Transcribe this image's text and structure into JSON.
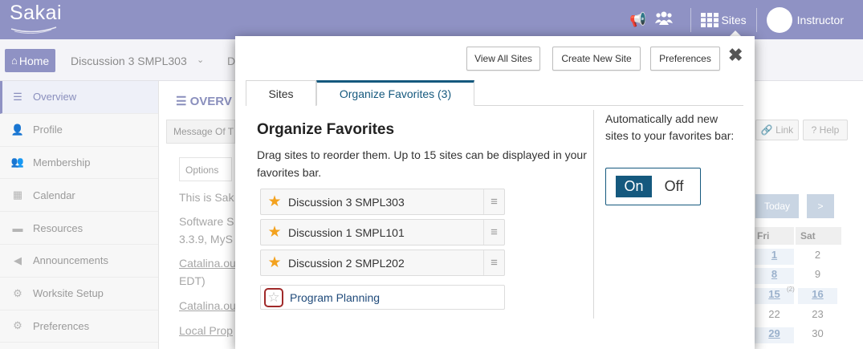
{
  "topbar": {
    "logo": "Sakai",
    "sites_label": "Sites",
    "user_name": "Instructor",
    "bg_color": "#8f92c4"
  },
  "breadcrumb": {
    "home_label": "Home",
    "site_name": "Discussion 3 SMPL303",
    "next_partial": "D"
  },
  "leftnav": {
    "items": [
      {
        "label": "Overview",
        "icon": "list-icon",
        "active": true
      },
      {
        "label": "Profile",
        "icon": "user-icon"
      },
      {
        "label": "Membership",
        "icon": "users-icon"
      },
      {
        "label": "Calendar",
        "icon": "calendar-icon"
      },
      {
        "label": "Resources",
        "icon": "folder-icon"
      },
      {
        "label": "Announcements",
        "icon": "megaphone-icon"
      },
      {
        "label": "Worksite Setup",
        "icon": "cogs-icon"
      },
      {
        "label": "Preferences",
        "icon": "gear-icon"
      }
    ]
  },
  "main": {
    "overview_title": "OVERV",
    "motd_label": "Message Of T",
    "options_label": "Options",
    "lines": [
      "This is Sak",
      "Software S",
      "3.3.9, MyS",
      "EDT)"
    ],
    "links": [
      "Catalina.ou",
      "Catalina.ou",
      "Local Prop"
    ],
    "link_btn": "Link",
    "help_btn": "Help",
    "today_btn": "Today",
    "next_btn": ">",
    "cal_days": [
      "Fri",
      "Sat"
    ],
    "cal_rows": [
      {
        "fri": "1",
        "sat": "2"
      },
      {
        "fri": "8",
        "sat": "9"
      },
      {
        "fri": "15",
        "sat": "16",
        "note": "(2)"
      },
      {
        "fri": "22",
        "sat": "23"
      },
      {
        "fri": "29",
        "sat": "30"
      }
    ]
  },
  "modal": {
    "view_all_label": "View All Sites",
    "create_new_label": "Create New Site",
    "preferences_label": "Preferences",
    "close_icon": "close-icon",
    "tabs": [
      {
        "label": "Sites",
        "active": false
      },
      {
        "label": "Organize Favorites (3)",
        "active": true
      }
    ],
    "heading": "Organize Favorites",
    "description": "Drag sites to reorder them. Up to 15 sites can be displayed in your favorites bar.",
    "favorites": [
      {
        "name": "Discussion 3 SMPL303",
        "starred": true
      },
      {
        "name": "Discussion 1 SMPL101",
        "starred": true
      },
      {
        "name": "Discussion 2 SMPL202",
        "starred": true
      },
      {
        "name": "Program Planning",
        "starred": false
      }
    ],
    "auto_add_text": "Automatically add new sites to your favorites bar:",
    "toggle_on": "On",
    "toggle_off": "Off",
    "accent_color": "#15597e",
    "star_color": "#f3a21e"
  }
}
